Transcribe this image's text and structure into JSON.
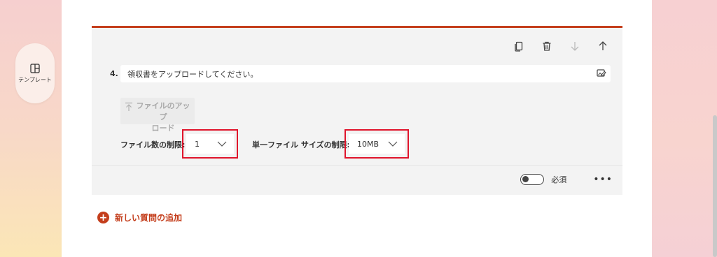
{
  "sidebar": {
    "template_label": "テンプレート",
    "template_icon": "layout-icon"
  },
  "question": {
    "number": "4.",
    "text": "領収書をアップロードしてください。",
    "upload_button_line1": "ファイルのアップ",
    "upload_button_line2": "ロード",
    "file_count_label": "ファイル数の制限:",
    "file_count_value": "1",
    "file_size_label": "単一ファイル サイズの制限:",
    "file_size_value": "10MB",
    "required_label": "必須",
    "required_enabled": false
  },
  "toolbar": {
    "icons": [
      "copy-icon",
      "delete-icon",
      "move-down-icon",
      "move-up-icon"
    ]
  },
  "actions": {
    "add_question_label": "新しい質問の追加"
  },
  "colors": {
    "accent": "#c43e1c",
    "highlight": "#e0142b",
    "card_bg": "#f3f3f3"
  }
}
